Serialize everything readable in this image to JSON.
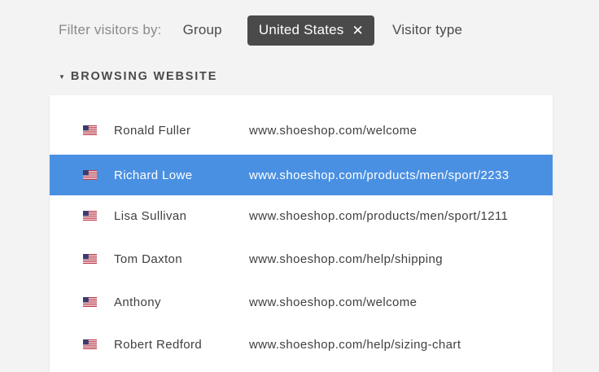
{
  "filter": {
    "label": "Filter visitors by:",
    "group_label": "Group",
    "active_chip_label": "United States",
    "chip_remove_glyph": "✕",
    "visitor_type_label": "Visitor type"
  },
  "section": {
    "caret": "▼",
    "title": "BROWSING WEBSITE"
  },
  "colors": {
    "selected_row": "#4a90e2",
    "chip_bg": "#4a4a4a"
  },
  "visitors": [
    {
      "flag_icon": "us-flag-icon",
      "name": "Ronald Fuller",
      "url": "www.shoeshop.com/welcome",
      "selected": false
    },
    {
      "flag_icon": "us-flag-icon",
      "name": "Richard Lowe",
      "url": "www.shoeshop.com/products/men/sport/2233",
      "selected": true
    },
    {
      "flag_icon": "us-flag-icon",
      "name": "Lisa Sullivan",
      "url": "www.shoeshop.com/products/men/sport/1211",
      "selected": false
    },
    {
      "flag_icon": "us-flag-icon",
      "name": "Tom Daxton",
      "url": "www.shoeshop.com/help/shipping",
      "selected": false
    },
    {
      "flag_icon": "us-flag-icon",
      "name": "Anthony",
      "url": "www.shoeshop.com/welcome",
      "selected": false
    },
    {
      "flag_icon": "us-flag-icon",
      "name": "Robert Redford",
      "url": "www.shoeshop.com/help/sizing-chart",
      "selected": false
    }
  ]
}
